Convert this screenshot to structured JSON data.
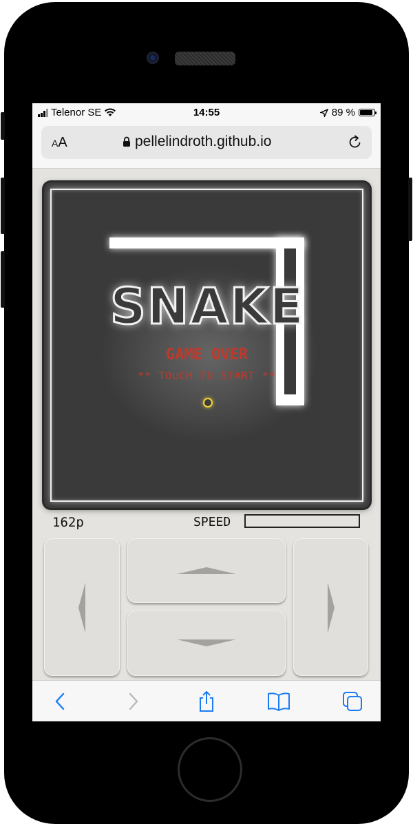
{
  "status_bar": {
    "carrier": "Telenor SE",
    "time": "14:55",
    "battery_percent": "89 %",
    "battery_level": 0.89
  },
  "browser": {
    "text_size_button": "AA",
    "url": "pellelindroth.github.io"
  },
  "game": {
    "title": "SNAKE",
    "status": "GAME OVER",
    "prompt": "** TOUCH TO START **",
    "colors": {
      "board": "#3a3a3a",
      "snake": "#ffffff",
      "status": "#c0392b",
      "food": "#f1d23a"
    }
  },
  "hud": {
    "score": "162p",
    "speed_label": "SPEED",
    "speed_level": 0
  },
  "controls": {
    "left": "arrow-left-icon",
    "up": "arrow-up-icon",
    "down": "arrow-down-icon",
    "right": "arrow-right-icon"
  },
  "toolbar": {
    "back": "chevron-left-icon",
    "forward": "chevron-right-icon",
    "share": "share-icon",
    "bookmarks": "book-icon",
    "tabs": "tabs-icon"
  }
}
